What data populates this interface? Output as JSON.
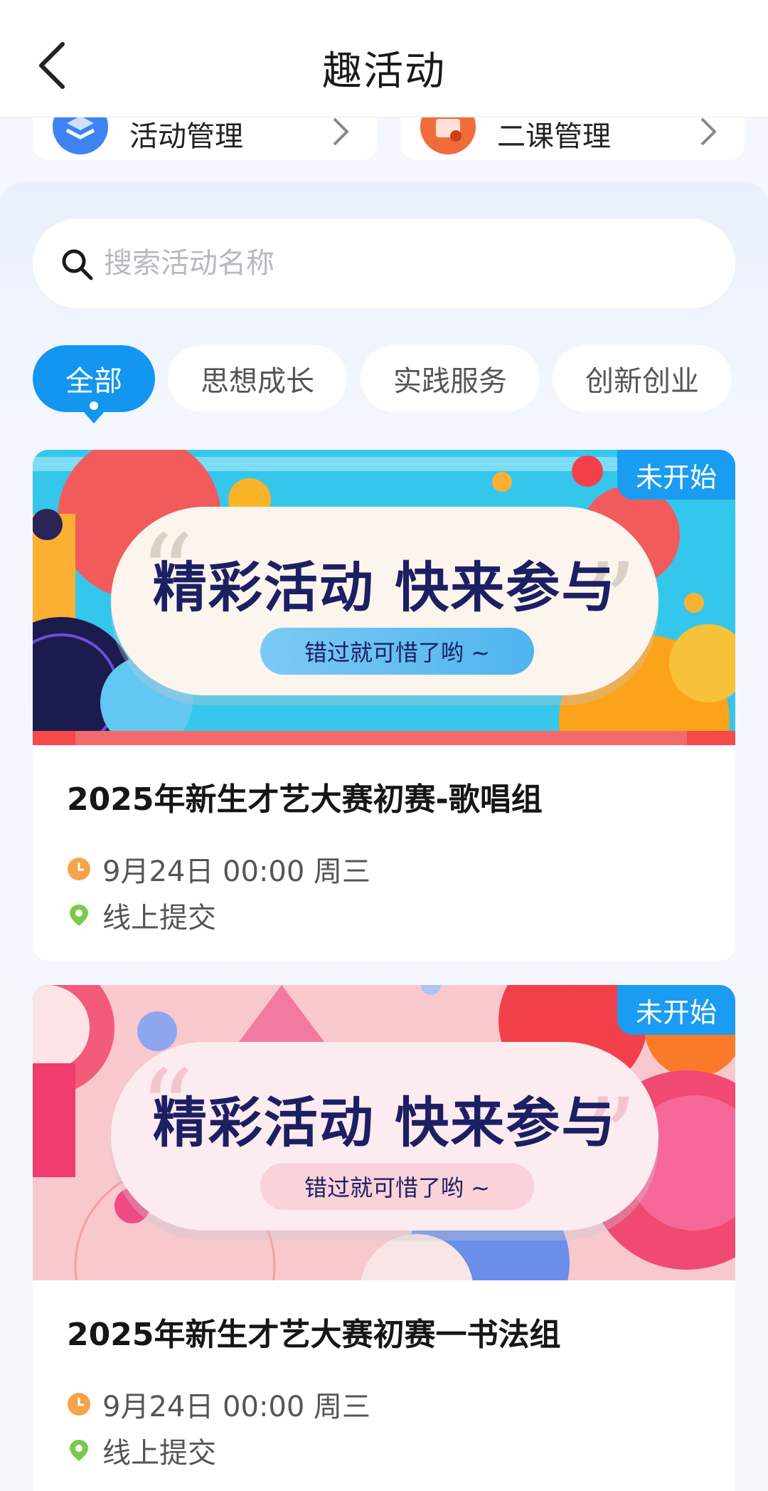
{
  "header": {
    "title": "趣活动"
  },
  "management": [
    {
      "label": "活动管理",
      "icon": "layers-icon",
      "color": "#3d84f2"
    },
    {
      "label": "二课管理",
      "icon": "briefcase-icon",
      "color": "#f26b3a"
    }
  ],
  "search": {
    "placeholder": "搜索活动名称"
  },
  "tabs": [
    {
      "label": "全部",
      "active": true
    },
    {
      "label": "思想成长",
      "active": false
    },
    {
      "label": "实践服务",
      "active": false
    },
    {
      "label": "创新创业",
      "active": false
    }
  ],
  "activities": [
    {
      "status": "未开始",
      "banner_title": "精彩活动 快来参与",
      "banner_subtitle": "错过就可惜了哟 ~",
      "title": "2025年新生才艺大赛初赛-歌唱组",
      "time": "9月24日 00:00 周三",
      "location": "线上提交"
    },
    {
      "status": "未开始",
      "banner_title": "精彩活动 快来参与",
      "banner_subtitle": "错过就可惜了哟 ~",
      "title": "2025年新生才艺大赛初赛一书法组",
      "time": "9月24日 00:00 周三",
      "location": "线上提交"
    }
  ],
  "colors": {
    "accent": "#1296f0",
    "clock_icon": "#f5a44a",
    "location_icon": "#7cc94a"
  }
}
